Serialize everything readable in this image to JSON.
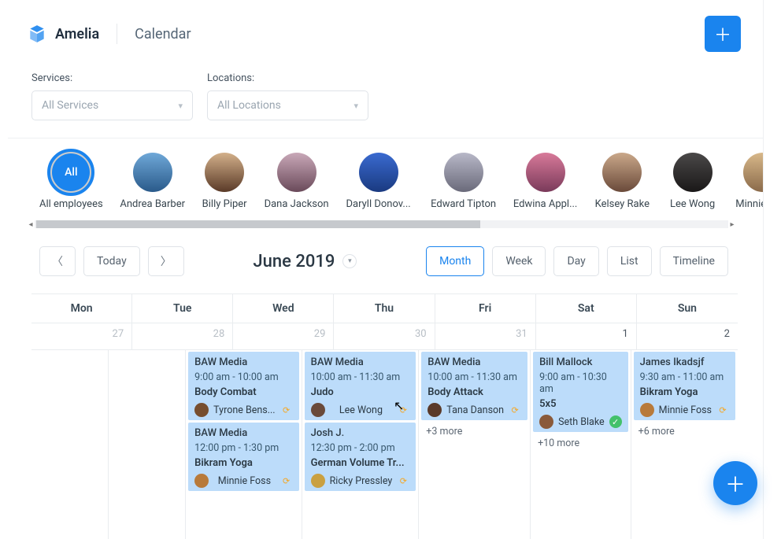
{
  "brand": {
    "name": "Amelia"
  },
  "page": {
    "title": "Calendar"
  },
  "filters": {
    "services": {
      "label": "Services:",
      "placeholder": "All Services"
    },
    "locations": {
      "label": "Locations:",
      "placeholder": "All Locations"
    }
  },
  "employees": [
    {
      "name": "All employees",
      "avatar_label": "All",
      "selected": true
    },
    {
      "name": "Andrea Barber"
    },
    {
      "name": "Billy Piper"
    },
    {
      "name": "Dana Jackson"
    },
    {
      "name": "Daryll Donov..."
    },
    {
      "name": "Edward Tipton"
    },
    {
      "name": "Edwina Appl..."
    },
    {
      "name": "Kelsey Rake"
    },
    {
      "name": "Lee Wong"
    },
    {
      "name": "Minnie Foss"
    }
  ],
  "toolbar": {
    "today": "Today",
    "title": "June 2019",
    "views": {
      "month": "Month",
      "week": "Week",
      "day": "Day",
      "list": "List",
      "timeline": "Timeline"
    },
    "active_view": "month"
  },
  "calendar": {
    "day_headers": [
      "Mon",
      "Tue",
      "Wed",
      "Thu",
      "Fri",
      "Sat",
      "Sun"
    ],
    "row0_days": [
      {
        "num": "27",
        "other": true
      },
      {
        "num": "28",
        "other": true
      },
      {
        "num": "29",
        "other": true
      },
      {
        "num": "30",
        "other": true
      },
      {
        "num": "31",
        "other": true
      },
      {
        "num": "1"
      },
      {
        "num": "2"
      }
    ]
  },
  "more": {
    "fri": "+3 more",
    "sat": "+10 more",
    "sun": "+6 more"
  },
  "events": {
    "wed": [
      {
        "title": "BAW Media",
        "time": "9:00 am - 10:00 am",
        "service": "Body Combat",
        "employee": "Tyrone Bens...",
        "status": "pending"
      },
      {
        "title": "BAW Media",
        "time": "12:00 pm - 1:30 pm",
        "service": "Bikram Yoga",
        "employee": "Minnie Foss",
        "status": "pending"
      }
    ],
    "thu": [
      {
        "title": "BAW Media",
        "time": "10:00 am - 11:30 am",
        "service": "Judo",
        "employee": "Lee Wong",
        "status": "pending"
      },
      {
        "title": "Josh J.",
        "time": "12:30 pm - 2:00 pm",
        "service": "German Volume Tr...",
        "employee": "Ricky Pressley",
        "status": "pending"
      }
    ],
    "fri": [
      {
        "title": "BAW Media",
        "time": "10:00 am - 11:30 am",
        "service": "Body Attack",
        "employee": "Tana Danson",
        "status": "pending"
      }
    ],
    "sat": [
      {
        "title": "Bill Mallock",
        "time": "9:00 am - 10:30 am",
        "service": "5x5",
        "employee": "Seth Blake",
        "status": "approved"
      }
    ],
    "sun": [
      {
        "title": "James Ikadsjf",
        "time": "9:30 am - 11:00 am",
        "service": "Bikram Yoga",
        "employee": "Minnie Foss",
        "status": "pending"
      }
    ]
  },
  "colors": {
    "accent": "#1a84ee",
    "event_bg": "#bcdcfa"
  }
}
